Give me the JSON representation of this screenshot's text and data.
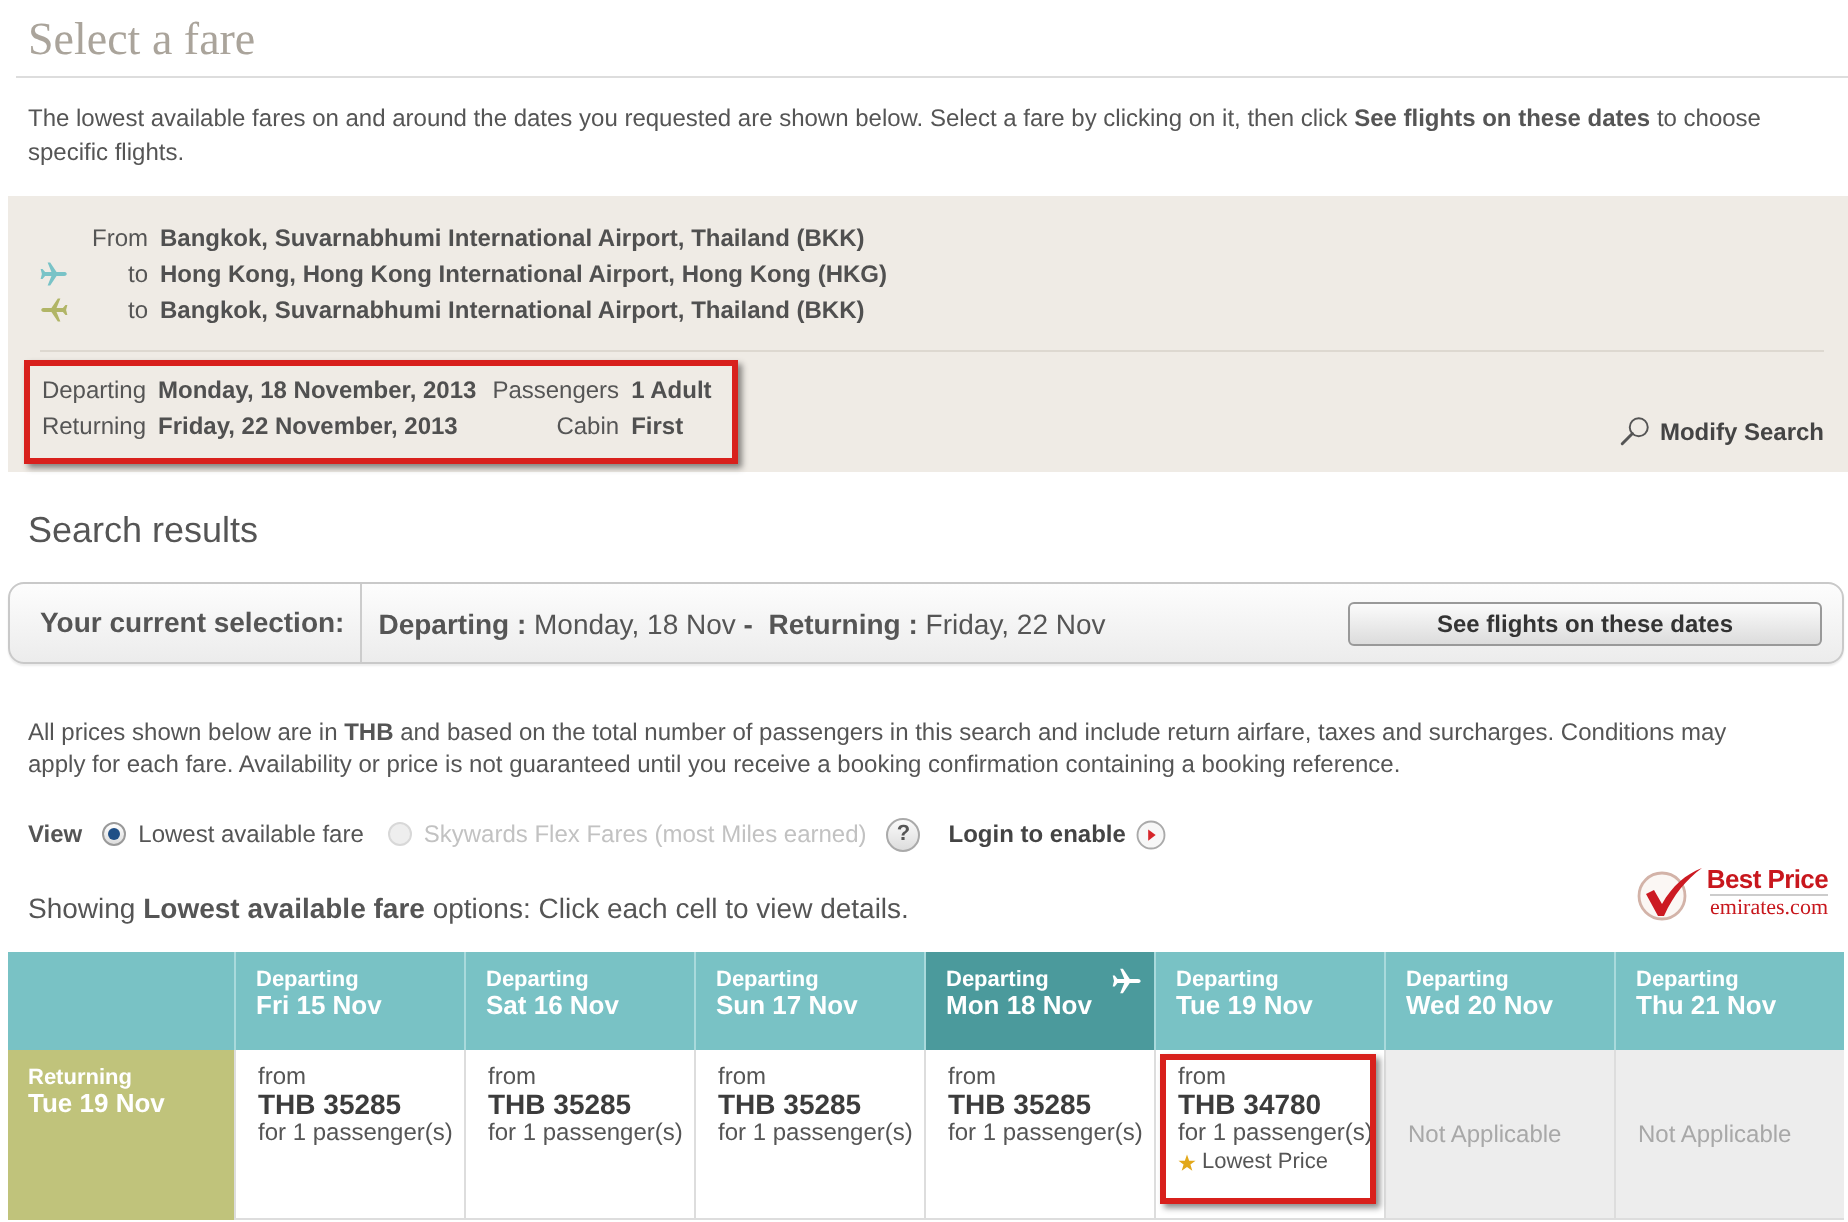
{
  "page_title": "Select a fare",
  "intro": "The lowest available fares on and around the dates you requested are shown below. Select a fare by clicking on it, then click **See flights on these dates** to choose specific flights.",
  "search_summary": {
    "route": [
      {
        "kind": "origin",
        "label": "From",
        "place": "Bangkok, Suvarnabhumi International Airport, Thailand (BKK)"
      },
      {
        "kind": "outbound",
        "label": "to",
        "place": "Hong Kong, Hong Kong International Airport, Hong Kong (HKG)"
      },
      {
        "kind": "return",
        "label": "to",
        "place": "Bangkok, Suvarnabhumi International Airport, Thailand (BKK)"
      }
    ],
    "details": {
      "highlighted": true,
      "rows": [
        {
          "label": "Departing",
          "value": "Monday, 18 November, 2013",
          "label_2": "Passengers",
          "value_2": "1 Adult"
        },
        {
          "label": "Returning",
          "value": "Friday, 22 November, 2013",
          "label_2": "Cabin",
          "value_2": "First"
        }
      ]
    },
    "modify_link": "Modify Search"
  },
  "results_title": "Search results",
  "selection_bar": {
    "label": "Your current selection:",
    "dates": "**Departing :** Monday, 18 Nov **-**  **Returning :** Friday, 22 Nov",
    "button": "See flights on these dates"
  },
  "prices_note": "All prices shown below are in **THB** and based on the total number of passengers in this search and include return airfare, taxes and surcharges. Conditions may apply for each fare. Availability or price is not guaranteed until you receive a booking confirmation containing a booking reference.",
  "view": {
    "label": "View",
    "options": [
      {
        "label": "Lowest available fare",
        "selected": true,
        "disabled": false
      },
      {
        "label": "Skywards Flex Fares (most Miles earned)",
        "selected": false,
        "disabled": true
      }
    ],
    "help": "?",
    "login_link": "Login to enable"
  },
  "showing": "Showing **Lowest available fare** options: Click each cell to view details.",
  "badge": {
    "title": "Best Price",
    "site": "emirates.com"
  },
  "fare_grid": {
    "columns": [
      {
        "label": "Departing",
        "date": "Fri 15 Nov",
        "selected": false
      },
      {
        "label": "Departing",
        "date": "Sat 16 Nov",
        "selected": false
      },
      {
        "label": "Departing",
        "date": "Sun 17 Nov",
        "selected": false
      },
      {
        "label": "Departing",
        "date": "Mon 18 Nov",
        "selected": true
      },
      {
        "label": "Departing",
        "date": "Tue 19 Nov",
        "selected": false
      },
      {
        "label": "Departing",
        "date": "Wed 20 Nov",
        "selected": false
      },
      {
        "label": "Departing",
        "date": "Thu 21 Nov",
        "selected": false
      }
    ],
    "rows": [
      {
        "label": "Returning",
        "date": "Tue 19 Nov",
        "cells": [
          {
            "kind": "fare",
            "from": "from",
            "price": "THB 35285",
            "note": "for 1 passenger(s)",
            "highlighted": false
          },
          {
            "kind": "fare",
            "from": "from",
            "price": "THB 35285",
            "note": "for 1 passenger(s)",
            "highlighted": false
          },
          {
            "kind": "fare",
            "from": "from",
            "price": "THB 35285",
            "note": "for 1 passenger(s)",
            "highlighted": false
          },
          {
            "kind": "fare",
            "from": "from",
            "price": "THB 35285",
            "note": "for 1 passenger(s)",
            "highlighted": false
          },
          {
            "kind": "fare",
            "from": "from",
            "price": "THB 34780",
            "note": "for 1 passenger(s)",
            "tag": "Lowest Price",
            "highlighted": true
          },
          {
            "kind": "unavailable",
            "text": "Not Applicable"
          },
          {
            "kind": "unavailable",
            "text": "Not Applicable"
          }
        ]
      }
    ]
  }
}
